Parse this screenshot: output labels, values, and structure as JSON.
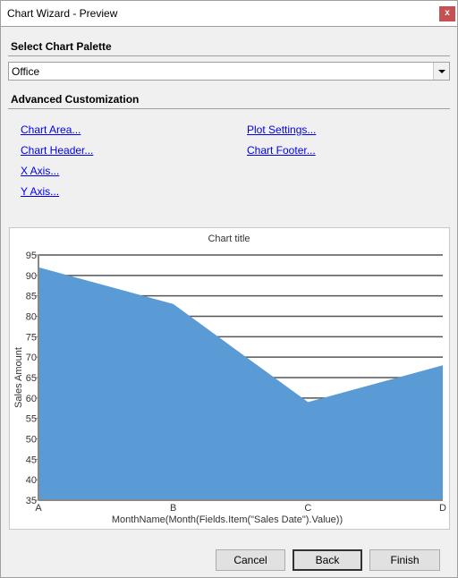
{
  "window": {
    "title": "Chart Wizard - Preview",
    "close_label": "x"
  },
  "palette": {
    "heading": "Select Chart Palette",
    "selected": "Office"
  },
  "advanced": {
    "heading": "Advanced Customization",
    "links": [
      "Chart Area...",
      "Plot Settings...",
      "Chart Header...",
      "Chart Footer...",
      "X Axis...",
      "Y Axis..."
    ]
  },
  "buttons": {
    "cancel": "Cancel",
    "back": "Back",
    "finish": "Finish"
  },
  "colors": {
    "area_fill": "#5b9bd5",
    "close_button": "#c75050",
    "link": "#0000ee"
  },
  "chart_data": {
    "type": "area",
    "title": "Chart title",
    "xlabel": "MonthName(Month(Fields.Item(\"Sales Date\").Value))",
    "ylabel": "Sales Amount",
    "categories": [
      "A",
      "B",
      "C",
      "D"
    ],
    "values": [
      92,
      83,
      59,
      68
    ],
    "ylim": [
      35,
      95
    ],
    "yticks": [
      35,
      40,
      45,
      50,
      55,
      60,
      65,
      70,
      75,
      80,
      85,
      90,
      95
    ],
    "grid": true,
    "legend": "none"
  }
}
